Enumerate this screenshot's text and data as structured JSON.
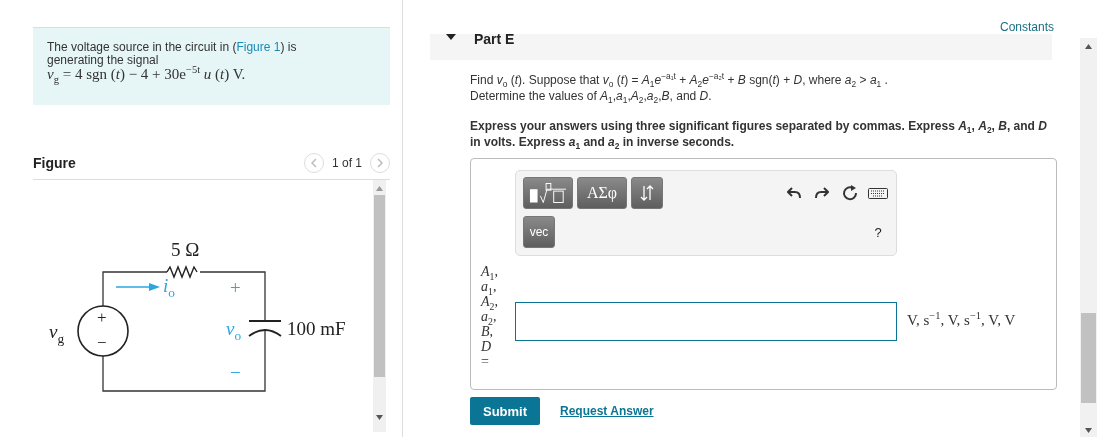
{
  "intro": {
    "text_before": "The voltage source in the circuit in (",
    "link": "Figure 1",
    "text_after": ") is generating the signal",
    "equation": "*v*$_{g}$ = 4 sgn (*t*) − 4 + 30e$^{−5t}$ *u* (*t*)  V."
  },
  "figure": {
    "heading": "Figure",
    "pager": "1 of 1"
  },
  "circuit": {
    "resistor": "5 Ω",
    "current": "*i*$_{o}$",
    "source": "*v*$_{g}$",
    "source_plus": "+",
    "source_minus": "−",
    "output": "*v*$_{o}$",
    "output_plus": "+",
    "output_minus": "−",
    "capacitor": "100 mF"
  },
  "constants_link": "Constants",
  "part": {
    "title": "Part E",
    "expanded": true
  },
  "question": [
    "Find *v*$_{o}$ (*t*). Suppose that *v*$_{o}$ (*t*) = *A*$_{1}$*e*$^{−a₁t}$ + *A*$_{2}$*e*$^{−a₂t}$ + *B* sgn(*t*) + *D*, where *a*$_{2}$ > *a*$_{1}$ .",
    "Determine the values of *A*$_{1}$,*a*$_{1}$,*A*$_{2}$,*a*$_{2}$,*B*, and *D*."
  ],
  "instructions": "Express your answers using three significant figures separated by commas. Express *A*$_{1}$, *A*$_{2}$, *B*, and *D* in volts. Express *a*$_{1}$ and *a*$_{2}$ in inverse seconds.",
  "toolbar": {
    "buttons": [
      {
        "kind": "templates"
      },
      {
        "kind": "text",
        "label": "ΑΣφ"
      },
      {
        "kind": "arrows"
      }
    ],
    "vec": "vec",
    "help": "?"
  },
  "answer": {
    "labels": [
      "*A*$_{1}$,",
      "*a*$_{1}$,",
      "*A*$_{2}$,",
      "*a*$_{2}$,",
      "*B*,",
      "*D*",
      "="
    ],
    "units": "V, s$^{−1}$, V, s$^{−1}$, V, V"
  },
  "submit": "Submit",
  "request_answer": "Request Answer"
}
